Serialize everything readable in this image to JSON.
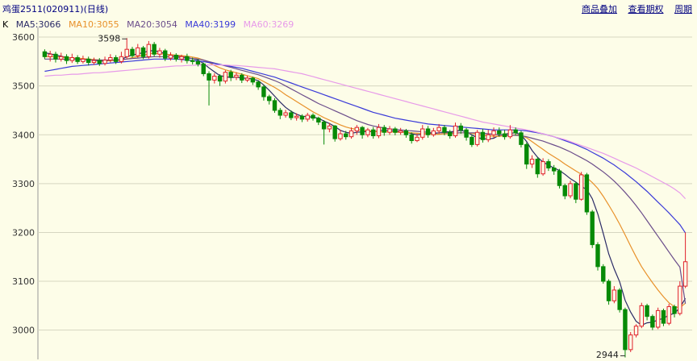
{
  "header": {
    "title": "鸡蛋2511(020911)(日线)",
    "links": [
      "商品叠加",
      "查看期权",
      "周期"
    ]
  },
  "legend": {
    "k_label": "K",
    "items": [
      {
        "label": "MA5:3066",
        "color": "#2a2a66"
      },
      {
        "label": "MA10:3055",
        "color": "#e8912a"
      },
      {
        "label": "MA20:3054",
        "color": "#6a4c8a"
      },
      {
        "label": "MA40:3199",
        "color": "#3a3ad8"
      },
      {
        "label": "MA60:3269",
        "color": "#e79ae9"
      }
    ]
  },
  "colors": {
    "up": "#e0202a",
    "down": "#078a07",
    "grid": "#d6d6c0",
    "axis_text": "#333333"
  },
  "chart_data": {
    "type": "candlestick",
    "ylim": [
      2940,
      3610
    ],
    "yticks": [
      3000,
      3100,
      3200,
      3300,
      3400,
      3500,
      3600
    ],
    "annotations": [
      {
        "label": "3598",
        "value": 3598
      },
      {
        "label": "2944",
        "value": 2944
      }
    ],
    "candles": [
      [
        3570,
        3560,
        3575,
        3555
      ],
      [
        3560,
        3565,
        3572,
        3550
      ],
      [
        3565,
        3555,
        3570,
        3548
      ],
      [
        3555,
        3560,
        3568,
        3550
      ],
      [
        3560,
        3552,
        3565,
        3545
      ],
      [
        3552,
        3558,
        3566,
        3547
      ],
      [
        3558,
        3550,
        3563,
        3545
      ],
      [
        3550,
        3555,
        3562,
        3546
      ],
      [
        3555,
        3548,
        3560,
        3542
      ],
      [
        3548,
        3552,
        3558,
        3543
      ],
      [
        3552,
        3546,
        3557,
        3541
      ],
      [
        3546,
        3553,
        3560,
        3542
      ],
      [
        3553,
        3558,
        3565,
        3548
      ],
      [
        3558,
        3550,
        3563,
        3545
      ],
      [
        3550,
        3560,
        3570,
        3546
      ],
      [
        3560,
        3575,
        3598,
        3556
      ],
      [
        3575,
        3562,
        3580,
        3558
      ],
      [
        3562,
        3578,
        3586,
        3558
      ],
      [
        3578,
        3560,
        3582,
        3555
      ],
      [
        3560,
        3585,
        3592,
        3556
      ],
      [
        3585,
        3565,
        3590,
        3560
      ],
      [
        3565,
        3572,
        3578,
        3558
      ],
      [
        3572,
        3557,
        3576,
        3551
      ],
      [
        3557,
        3563,
        3569,
        3552
      ],
      [
        3563,
        3555,
        3567,
        3550
      ],
      [
        3555,
        3560,
        3564,
        3548
      ],
      [
        3560,
        3552,
        3566,
        3546
      ],
      [
        3552,
        3550,
        3558,
        3544
      ],
      [
        3550,
        3545,
        3555,
        3540
      ],
      [
        3545,
        3525,
        3548,
        3520
      ],
      [
        3525,
        3512,
        3530,
        3460
      ],
      [
        3512,
        3520,
        3526,
        3505
      ],
      [
        3520,
        3510,
        3524,
        3500
      ],
      [
        3510,
        3528,
        3532,
        3505
      ],
      [
        3528,
        3518,
        3533,
        3510
      ],
      [
        3518,
        3522,
        3528,
        3512
      ],
      [
        3522,
        3512,
        3526,
        3506
      ],
      [
        3512,
        3516,
        3521,
        3508
      ],
      [
        3516,
        3508,
        3519,
        3502
      ],
      [
        3508,
        3498,
        3511,
        3492
      ],
      [
        3498,
        3478,
        3502,
        3470
      ],
      [
        3478,
        3470,
        3482,
        3462
      ],
      [
        3470,
        3450,
        3475,
        3445
      ],
      [
        3450,
        3440,
        3455,
        3432
      ],
      [
        3440,
        3445,
        3451,
        3435
      ],
      [
        3445,
        3435,
        3450,
        3430
      ],
      [
        3435,
        3438,
        3444,
        3429
      ],
      [
        3438,
        3432,
        3442,
        3426
      ],
      [
        3432,
        3440,
        3445,
        3427
      ],
      [
        3440,
        3434,
        3444,
        3429
      ],
      [
        3434,
        3426,
        3437,
        3420
      ],
      [
        3426,
        3412,
        3430,
        3380
      ],
      [
        3412,
        3418,
        3424,
        3405
      ],
      [
        3418,
        3392,
        3420,
        3386
      ],
      [
        3392,
        3402,
        3410,
        3388
      ],
      [
        3402,
        3396,
        3408,
        3390
      ],
      [
        3396,
        3408,
        3415,
        3392
      ],
      [
        3408,
        3415,
        3420,
        3400
      ],
      [
        3415,
        3400,
        3418,
        3392
      ],
      [
        3400,
        3410,
        3414,
        3395
      ],
      [
        3410,
        3398,
        3416,
        3392
      ],
      [
        3398,
        3415,
        3422,
        3393
      ],
      [
        3415,
        3405,
        3420,
        3398
      ],
      [
        3405,
        3412,
        3418,
        3400
      ],
      [
        3412,
        3405,
        3416,
        3399
      ],
      [
        3405,
        3408,
        3414,
        3400
      ],
      [
        3408,
        3400,
        3412,
        3394
      ],
      [
        3400,
        3388,
        3405,
        3382
      ],
      [
        3388,
        3395,
        3402,
        3385
      ],
      [
        3395,
        3412,
        3420,
        3390
      ],
      [
        3412,
        3400,
        3418,
        3394
      ],
      [
        3400,
        3408,
        3414,
        3396
      ],
      [
        3408,
        3415,
        3422,
        3402
      ],
      [
        3415,
        3405,
        3420,
        3399
      ],
      [
        3405,
        3398,
        3410,
        3392
      ],
      [
        3398,
        3418,
        3425,
        3394
      ],
      [
        3418,
        3410,
        3424,
        3402
      ],
      [
        3410,
        3395,
        3414,
        3388
      ],
      [
        3395,
        3380,
        3400,
        3375
      ],
      [
        3380,
        3405,
        3410,
        3376
      ],
      [
        3405,
        3390,
        3412,
        3384
      ],
      [
        3390,
        3400,
        3410,
        3385
      ],
      [
        3400,
        3408,
        3415,
        3394
      ],
      [
        3408,
        3402,
        3415,
        3396
      ],
      [
        3402,
        3396,
        3410,
        3390
      ],
      [
        3396,
        3410,
        3420,
        3392
      ],
      [
        3410,
        3404,
        3415,
        3398
      ],
      [
        3404,
        3380,
        3408,
        3374
      ],
      [
        3380,
        3340,
        3384,
        3330
      ],
      [
        3340,
        3350,
        3358,
        3332
      ],
      [
        3350,
        3320,
        3354,
        3312
      ],
      [
        3320,
        3345,
        3352,
        3316
      ],
      [
        3345,
        3332,
        3350,
        3326
      ],
      [
        3332,
        3326,
        3338,
        3318
      ],
      [
        3326,
        3296,
        3330,
        3290
      ],
      [
        3296,
        3275,
        3300,
        3268
      ],
      [
        3275,
        3300,
        3306,
        3270
      ],
      [
        3300,
        3268,
        3304,
        3260
      ],
      [
        3268,
        3318,
        3324,
        3265
      ],
      [
        3318,
        3242,
        3322,
        3236
      ],
      [
        3242,
        3175,
        3246,
        3168
      ],
      [
        3175,
        3130,
        3180,
        3122
      ],
      [
        3130,
        3100,
        3135,
        3095
      ],
      [
        3100,
        3060,
        3104,
        3052
      ],
      [
        3060,
        3082,
        3090,
        3055
      ],
      [
        3082,
        3042,
        3086,
        3036
      ],
      [
        3042,
        2960,
        3046,
        2944
      ],
      [
        2960,
        2990,
        2996,
        2955
      ],
      [
        2990,
        3008,
        3012,
        2985
      ],
      [
        3008,
        3050,
        3056,
        3004
      ],
      [
        3050,
        3028,
        3054,
        3020
      ],
      [
        3028,
        3006,
        3032,
        3000
      ],
      [
        3006,
        3040,
        3046,
        3002
      ],
      [
        3040,
        3014,
        3044,
        3008
      ],
      [
        3014,
        3048,
        3054,
        3010
      ],
      [
        3048,
        3034,
        3052,
        3026
      ],
      [
        3034,
        3090,
        3100,
        3030
      ],
      [
        3090,
        3140,
        3200,
        3086
      ]
    ],
    "ma_lines": [
      {
        "name": "MA5",
        "values": [
          3568,
          3566,
          3563,
          3561,
          3558,
          3557,
          3556,
          3555,
          3554,
          3553,
          3551,
          3551,
          3552,
          3553,
          3554,
          3560,
          3563,
          3566,
          3568,
          3572,
          3572,
          3570,
          3566,
          3563,
          3562,
          3560,
          3558,
          3556,
          3553,
          3546,
          3537,
          3529,
          3521,
          3519,
          3517,
          3518,
          3516,
          3516,
          3514,
          3511,
          3502,
          3491,
          3479,
          3467,
          3456,
          3448,
          3442,
          3438,
          3437,
          3436,
          3434,
          3428,
          3423,
          3417,
          3409,
          3405,
          3403,
          3405,
          3406,
          3407,
          3406,
          3408,
          3410,
          3408,
          3408,
          3406,
          3406,
          3402,
          3400,
          3401,
          3403,
          3402,
          3404,
          3406,
          3406,
          3407,
          3409,
          3406,
          3400,
          3394,
          3392,
          3391,
          3393,
          3399,
          3401,
          3403,
          3404,
          3400,
          3386,
          3368,
          3354,
          3344,
          3338,
          3332,
          3327,
          3319,
          3310,
          3303,
          3294,
          3288,
          3269,
          3238,
          3198,
          3156,
          3125,
          3099,
          3061,
          3037,
          3018,
          3010,
          3015,
          3016,
          3021,
          3024,
          3031,
          3034,
          3046,
          3065
        ]
      },
      {
        "name": "MA10",
        "values": [
          3560,
          3560,
          3560,
          3559,
          3558,
          3557,
          3557,
          3556,
          3555,
          3554,
          3553,
          3552,
          3552,
          3552,
          3553,
          3555,
          3558,
          3560,
          3563,
          3566,
          3567,
          3566,
          3565,
          3564,
          3563,
          3562,
          3561,
          3559,
          3557,
          3553,
          3548,
          3542,
          3537,
          3533,
          3530,
          3527,
          3524,
          3521,
          3518,
          3515,
          3509,
          3503,
          3497,
          3490,
          3482,
          3475,
          3468,
          3461,
          3454,
          3447,
          3441,
          3435,
          3430,
          3425,
          3420,
          3416,
          3413,
          3411,
          3409,
          3408,
          3407,
          3406,
          3406,
          3406,
          3405,
          3405,
          3405,
          3404,
          3403,
          3402,
          3402,
          3401,
          3401,
          3402,
          3402,
          3403,
          3404,
          3404,
          3403,
          3401,
          3399,
          3398,
          3397,
          3397,
          3398,
          3399,
          3400,
          3399,
          3394,
          3386,
          3378,
          3370,
          3362,
          3355,
          3348,
          3340,
          3333,
          3326,
          3319,
          3312,
          3302,
          3290,
          3274,
          3256,
          3237,
          3217,
          3195,
          3172,
          3150,
          3130,
          3113,
          3097,
          3082,
          3068,
          3056,
          3048,
          3046,
          3055
        ]
      },
      {
        "name": "MA20",
        "values": [
          3555,
          3555,
          3555,
          3555,
          3554,
          3554,
          3554,
          3554,
          3553,
          3553,
          3553,
          3553,
          3553,
          3553,
          3554,
          3555,
          3556,
          3557,
          3558,
          3559,
          3560,
          3560,
          3560,
          3560,
          3559,
          3558,
          3557,
          3556,
          3555,
          3553,
          3550,
          3547,
          3544,
          3541,
          3538,
          3535,
          3532,
          3529,
          3526,
          3523,
          3519,
          3515,
          3511,
          3506,
          3500,
          3494,
          3488,
          3482,
          3476,
          3470,
          3464,
          3459,
          3454,
          3449,
          3444,
          3439,
          3434,
          3429,
          3425,
          3421,
          3418,
          3416,
          3414,
          3412,
          3411,
          3410,
          3409,
          3408,
          3407,
          3406,
          3405,
          3404,
          3404,
          3404,
          3404,
          3404,
          3404,
          3404,
          3404,
          3404,
          3403,
          3402,
          3401,
          3400,
          3399,
          3399,
          3399,
          3398,
          3396,
          3393,
          3390,
          3387,
          3383,
          3379,
          3375,
          3370,
          3365,
          3359,
          3353,
          3347,
          3340,
          3332,
          3324,
          3315,
          3305,
          3294,
          3282,
          3269,
          3255,
          3240,
          3224,
          3208,
          3192,
          3176,
          3160,
          3144,
          3129,
          3054
        ]
      },
      {
        "name": "MA40",
        "values": [
          3530,
          3532,
          3534,
          3536,
          3538,
          3540,
          3541,
          3542,
          3543,
          3544,
          3545,
          3546,
          3547,
          3548,
          3549,
          3550,
          3551,
          3552,
          3553,
          3554,
          3555,
          3555,
          3555,
          3555,
          3555,
          3554,
          3553,
          3552,
          3551,
          3550,
          3548,
          3546,
          3544,
          3542,
          3540,
          3538,
          3536,
          3533,
          3530,
          3527,
          3524,
          3521,
          3518,
          3514,
          3510,
          3506,
          3502,
          3498,
          3494,
          3490,
          3486,
          3482,
          3478,
          3474,
          3470,
          3466,
          3462,
          3458,
          3454,
          3450,
          3446,
          3443,
          3440,
          3437,
          3434,
          3432,
          3430,
          3428,
          3426,
          3424,
          3422,
          3421,
          3420,
          3419,
          3418,
          3417,
          3416,
          3415,
          3414,
          3413,
          3412,
          3411,
          3410,
          3410,
          3410,
          3410,
          3410,
          3409,
          3408,
          3406,
          3404,
          3402,
          3399,
          3396,
          3392,
          3388,
          3384,
          3380,
          3375,
          3370,
          3364,
          3358,
          3352,
          3345,
          3338,
          3330,
          3322,
          3313,
          3304,
          3294,
          3284,
          3273,
          3262,
          3251,
          3240,
          3228,
          3216,
          3199
        ]
      },
      {
        "name": "MA60",
        "values": [
          3520,
          3521,
          3522,
          3522,
          3523,
          3524,
          3524,
          3525,
          3526,
          3527,
          3527,
          3528,
          3529,
          3530,
          3531,
          3532,
          3533,
          3534,
          3535,
          3536,
          3537,
          3538,
          3539,
          3540,
          3541,
          3541,
          3542,
          3542,
          3543,
          3543,
          3543,
          3543,
          3543,
          3543,
          3542,
          3542,
          3541,
          3540,
          3539,
          3538,
          3537,
          3536,
          3535,
          3533,
          3531,
          3529,
          3527,
          3525,
          3522,
          3519,
          3516,
          3513,
          3510,
          3507,
          3504,
          3501,
          3498,
          3495,
          3492,
          3489,
          3486,
          3483,
          3480,
          3477,
          3474,
          3471,
          3468,
          3465,
          3462,
          3459,
          3456,
          3453,
          3450,
          3447,
          3444,
          3441,
          3438,
          3435,
          3432,
          3429,
          3426,
          3424,
          3422,
          3420,
          3418,
          3416,
          3414,
          3412,
          3410,
          3408,
          3405,
          3402,
          3399,
          3396,
          3393,
          3390,
          3386,
          3382,
          3378,
          3374,
          3370,
          3366,
          3362,
          3357,
          3352,
          3347,
          3342,
          3337,
          3332,
          3326,
          3320,
          3314,
          3308,
          3302,
          3296,
          3289,
          3281,
          3269
        ]
      }
    ]
  }
}
